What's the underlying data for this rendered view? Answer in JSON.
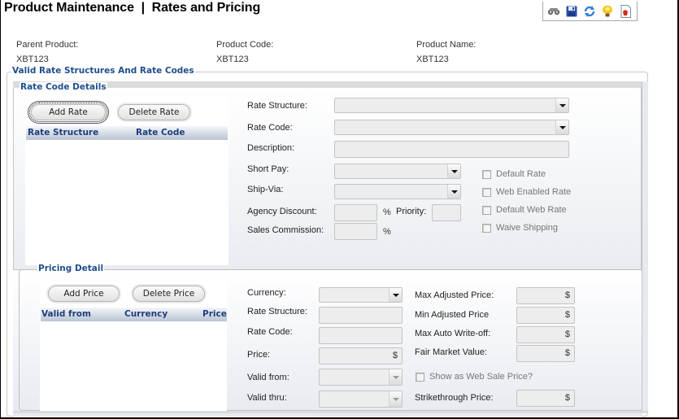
{
  "header": {
    "title": "Product Maintenance  |  Rates and Pricing",
    "toolbar_icons": [
      "binoculars-icon",
      "save-icon",
      "refresh-icon",
      "lightbulb-icon",
      "report-icon"
    ]
  },
  "product": {
    "parent_label": "Parent Product:",
    "parent_value": "XBT123",
    "code_label": "Product Code:",
    "code_value": "XBT123",
    "name_label": "Product Name:",
    "name_value": "XBT123"
  },
  "rate_section": {
    "legend": "Valid Rate Structures And Rate Codes",
    "details_legend": "Rate Code Details",
    "add_button": "Add Rate",
    "delete_button": "Delete Rate",
    "grid_columns": [
      "Rate Structure",
      "Rate Code"
    ],
    "grid_rows": [],
    "fields": {
      "rate_structure": {
        "label": "Rate Structure:",
        "value": ""
      },
      "rate_code": {
        "label": "Rate Code:",
        "value": ""
      },
      "description": {
        "label": "Description:",
        "value": ""
      },
      "short_pay": {
        "label": "Short Pay:",
        "value": ""
      },
      "ship_via": {
        "label": "Ship-Via:",
        "value": ""
      },
      "agency_discount": {
        "label": "Agency Discount:",
        "value": "",
        "suffix": "%"
      },
      "priority": {
        "label": "Priority:",
        "value": ""
      },
      "sales_commission": {
        "label": "Sales Commission:",
        "value": "",
        "suffix": "%"
      }
    },
    "checkboxes": [
      {
        "label": "Default Rate",
        "checked": false
      },
      {
        "label": "Web Enabled Rate",
        "checked": false
      },
      {
        "label": "Default Web Rate",
        "checked": false
      },
      {
        "label": "Waive Shipping",
        "checked": false
      }
    ]
  },
  "pricing_section": {
    "legend": "Pricing Detail",
    "add_button": "Add Price",
    "delete_button": "Delete Price",
    "grid_columns": [
      "Valid from",
      "Currency",
      "Price"
    ],
    "grid_rows": [],
    "fields": {
      "currency": {
        "label": "Currency:",
        "value": ""
      },
      "rate_structure": {
        "label": "Rate Structure:",
        "value": ""
      },
      "rate_code": {
        "label": "Rate Code:",
        "value": ""
      },
      "price": {
        "label": "Price:",
        "value": "",
        "suffix": "$"
      },
      "valid_from": {
        "label": "Valid from:",
        "value": ""
      },
      "valid_thru": {
        "label": "Valid thru:",
        "value": ""
      },
      "max_adjusted_price": {
        "label": "Max Adjusted Price:",
        "value": "",
        "suffix": "$"
      },
      "min_adjusted_price": {
        "label": "Min Adjusted Price",
        "value": "",
        "suffix": "$"
      },
      "max_auto_writeoff": {
        "label": "Max Auto Write-off:",
        "value": "",
        "suffix": "$"
      },
      "fair_market_value": {
        "label": "Fair Market Value:",
        "value": "",
        "suffix": "$"
      },
      "strikethrough_price": {
        "label": "Strikethrough Price:",
        "value": "",
        "suffix": "$"
      }
    },
    "web_sale_checkbox": {
      "label": "Show as Web Sale Price?",
      "checked": false
    }
  }
}
